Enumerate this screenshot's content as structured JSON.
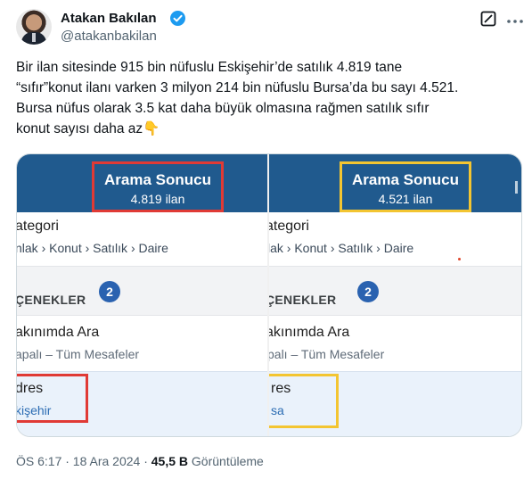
{
  "author": {
    "name": "Atakan Bakılan",
    "handle": "@atakanbakilan",
    "verified_color": "#1d9bf0"
  },
  "icons": {
    "verified": "verified-badge-icon",
    "grok": "grok-icon",
    "more": "more-options-icon"
  },
  "tweet": {
    "lines": [
      "Bir ilan sitesinde 915 bin nüfuslu Eskişehir’de satılık 4.819 tane",
      "“sıfır”konut ilanı varken 3 milyon 214 bin nüfuslu Bursa’da bu sayı 4.521.",
      "Bursa nüfus olarak 3.5 kat daha büyük olmasına rağmen satılık sıfır",
      "konut sayısı daha az👇"
    ]
  },
  "media": {
    "left": {
      "result_title": "Arama Sonucu",
      "result_count": "4.819 ilan",
      "highlight_color": "#e03a35",
      "category_label": "ategori",
      "category_path": "nlak › Konut › Satılık › Daire",
      "options_label": "ÇENEKLER",
      "options_count": "2",
      "nearby_label": "akınımda Ara",
      "nearby_value": "apalı – Tüm Mesafeler",
      "address_label": "dres",
      "address_value": "kişehir"
    },
    "right": {
      "result_title": "Arama Sonucu",
      "result_count": "4.521 ilan",
      "highlight_color": "#f3c531",
      "category_label": "ategori",
      "category_path": "lak › Konut › Satılık › Daire",
      "options_label": "ÇENEKLER",
      "options_count": "2",
      "nearby_label": "akınımda Ara",
      "nearby_value": "palı – Tüm Mesafeler",
      "address_label": "res",
      "address_value": "sa"
    },
    "header_color": "#205a8e"
  },
  "footer": {
    "time": "ÖS 6:17 · 18 Ara 2024 ·",
    "views_count": "45,5 B",
    "views_label": "Görüntüleme"
  }
}
